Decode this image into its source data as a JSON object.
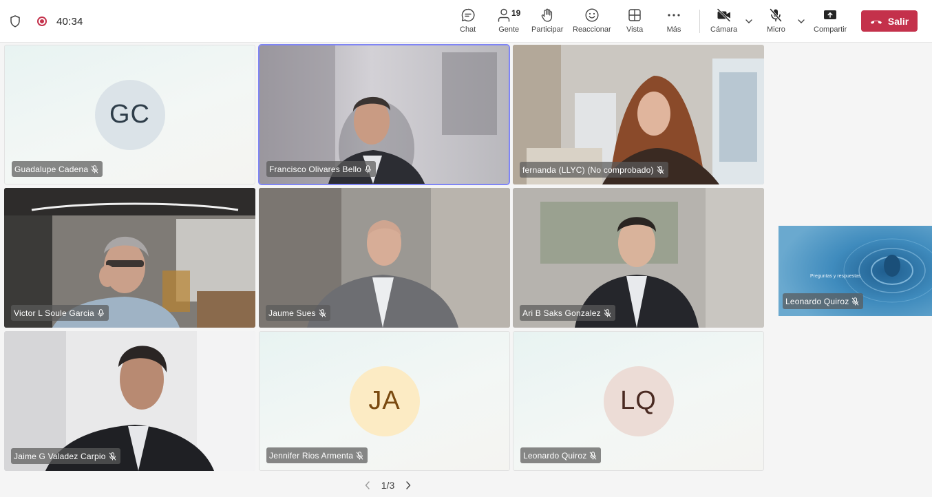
{
  "meeting": {
    "timer": "40:34"
  },
  "toolbar": {
    "chat": "Chat",
    "people": "Gente",
    "people_count": "19",
    "raise_hand": "Participar",
    "react": "Reaccionar",
    "view": "Vista",
    "more": "Más",
    "camera": "Cámara",
    "mic": "Micro",
    "share": "Compartir",
    "leave": "Salir"
  },
  "participants": [
    {
      "name": "Guadalupe Cadena",
      "initials": "GC",
      "video": false,
      "avatar_bg": "#dbe3e8",
      "avatar_fg": "#2f3e4a"
    },
    {
      "name": "Francisco Olivares Bello",
      "video": true,
      "active_speaker": true
    },
    {
      "name": "fernanda (LLYC) (No comprobado)",
      "video": true
    },
    {
      "name": "Victor L Soule Garcia",
      "video": true
    },
    {
      "name": "Jaume Sues",
      "video": true
    },
    {
      "name": "Ari B Saks Gonzalez",
      "video": true
    },
    {
      "name": "Jaime G Valadez Carpio",
      "video": true
    },
    {
      "name": "Jennifer Rios Armenta",
      "initials": "JA",
      "video": false,
      "avatar_bg": "#fcebc4",
      "avatar_fg": "#7a4a10"
    },
    {
      "name": "Leonardo Quiroz",
      "initials": "LQ",
      "video": false,
      "avatar_bg": "#ecdcd6",
      "avatar_fg": "#4a2a22"
    }
  ],
  "stage": {
    "presenter": "Leonardo Quiroz",
    "slide_text": "Preguntas y respuestas"
  },
  "pager": {
    "text": "1/3"
  },
  "colors": {
    "leave": "#c4314b",
    "active_border": "#7f85f5",
    "recording": "#c4314b"
  }
}
